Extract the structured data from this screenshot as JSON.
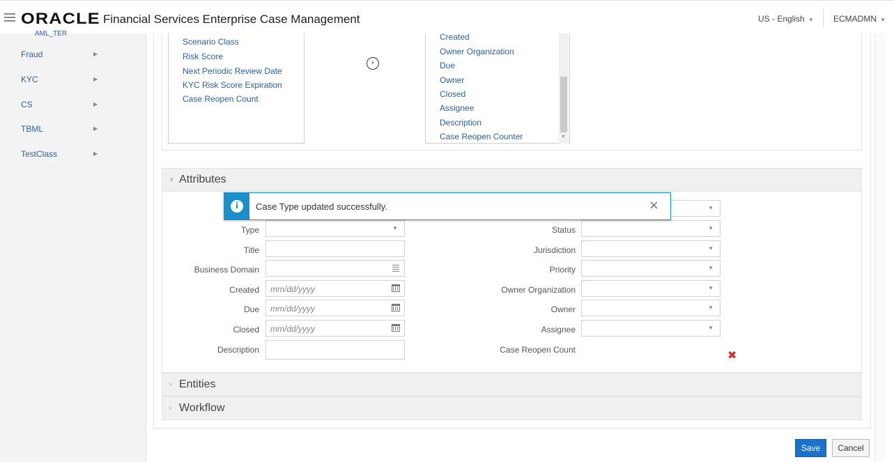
{
  "header": {
    "logo": "ORACLE",
    "app_title": "Financial Services Enterprise Case Management",
    "language": "US - English",
    "user": "ECMADMN"
  },
  "sidebar": {
    "partial_item": "AML_TER",
    "items": [
      {
        "label": "Fraud"
      },
      {
        "label": "KYC"
      },
      {
        "label": "CS"
      },
      {
        "label": "TBML"
      },
      {
        "label": "TestClass"
      }
    ]
  },
  "available_fields": [
    "Scenario Class",
    "Risk Score",
    "Next Periodic Review Date",
    "KYC Risk Score Expiration",
    "Case Reopen Count"
  ],
  "selected_fields": [
    "Created",
    "Owner Organization",
    "Due",
    "Owner",
    "Closed",
    "Assignee",
    "Description",
    "Case Reopen Counter"
  ],
  "sections": {
    "attributes": "Attributes",
    "entities": "Entities",
    "workflow": "Workflow"
  },
  "toast": {
    "message": "Case Type updated successfully."
  },
  "attributes_left": {
    "type": "Type",
    "title": "Title",
    "business_domain": "Business Domain",
    "created": "Created",
    "due": "Due",
    "closed": "Closed",
    "description": "Description",
    "date_placeholder": "mm/dd/yyyy"
  },
  "attributes_right": {
    "status": "Status",
    "jurisdiction": "Jurisdiction",
    "priority": "Priority",
    "owner_organization": "Owner Organization",
    "owner": "Owner",
    "assignee": "Assignee",
    "case_reopen_count": "Case Reopen Count"
  },
  "buttons": {
    "save": "Save",
    "cancel": "Cancel"
  }
}
